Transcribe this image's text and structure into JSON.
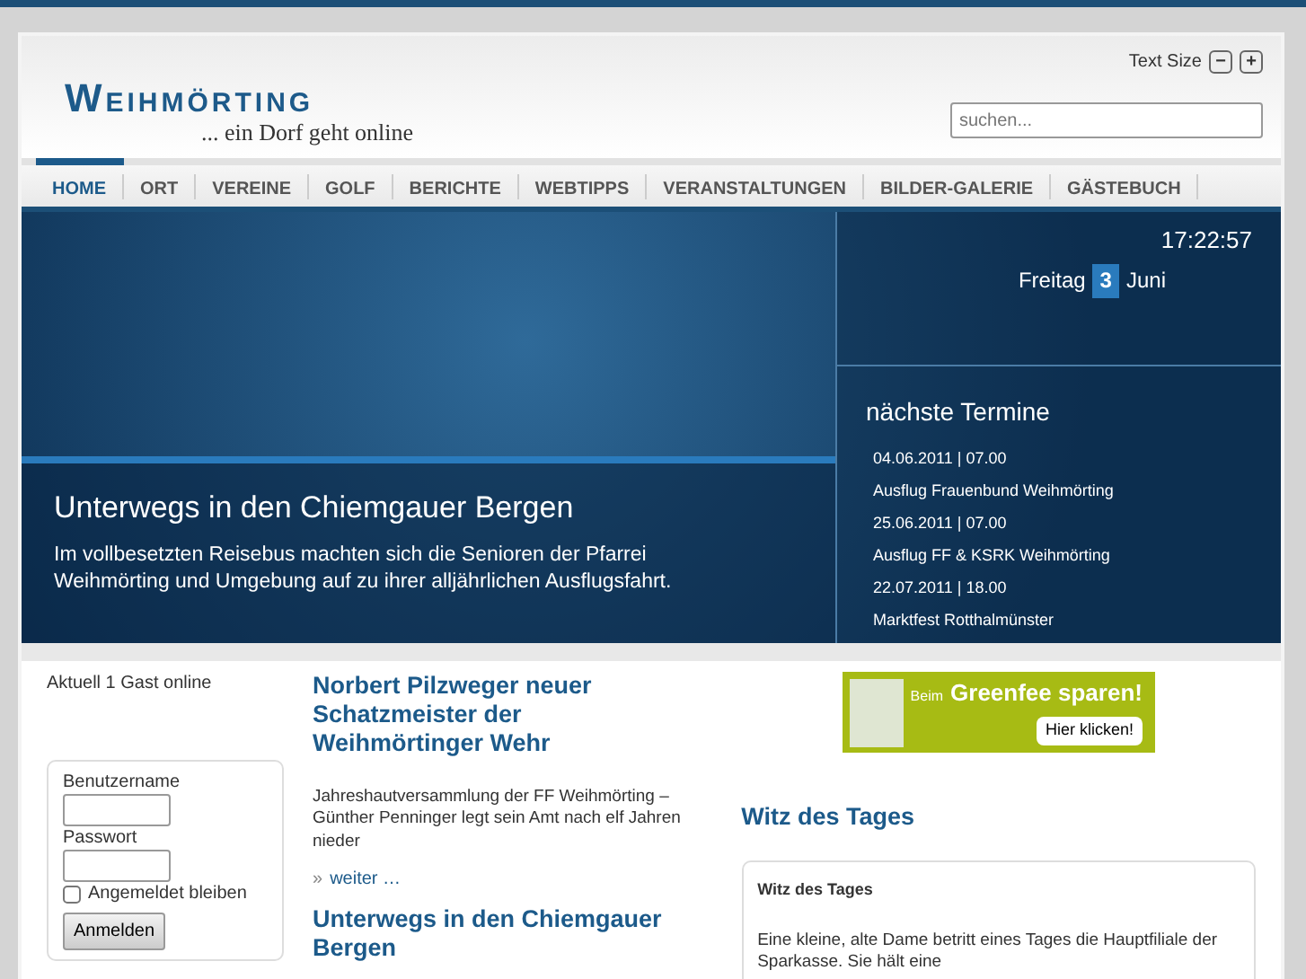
{
  "header": {
    "logo_title": "Weihmörting",
    "logo_tagline": "... ein Dorf geht online",
    "text_size_label": "Text Size",
    "text_size_buttons": [
      "−",
      "+"
    ],
    "search": {
      "placeholder": "suchen..."
    }
  },
  "nav": [
    {
      "label": "HOME",
      "selected": true
    },
    {
      "label": "ORT",
      "selected": false
    },
    {
      "label": "VEREINE",
      "selected": false
    },
    {
      "label": "GOLF",
      "selected": false
    },
    {
      "label": "BERICHTE",
      "selected": false
    },
    {
      "label": "WEBTIPPS",
      "selected": false
    },
    {
      "label": "VERANSTALTUNGEN",
      "selected": false
    },
    {
      "label": "BILDER-GALERIE",
      "selected": false
    },
    {
      "label": "GÄSTEBUCH",
      "selected": false
    }
  ],
  "hero": {
    "title": "Unterwegs in den Chiemgauer Bergen",
    "text": "Im vollbesetzten Reisebus machten sich die Senioren der Pfarrei Weihmörting und Umgebung auf zu ihrer alljährlichen Ausflugsfahrt."
  },
  "clock": {
    "time": "17:22:57",
    "weekday": "Freitag",
    "day": "3",
    "month": "Juni"
  },
  "events": {
    "title": "nächste Termine",
    "items": [
      {
        "date": "04.06.2011 | 07.00",
        "name": "Ausflug Frauenbund Weihmörting"
      },
      {
        "date": "25.06.2011 | 07.00",
        "name": "Ausflug FF & KSRK Weihmörting"
      },
      {
        "date": "22.07.2011 | 18.00",
        "name": "Marktfest Rotthalmünster"
      }
    ]
  },
  "sidebar": {
    "online": "Aktuell 1 Gast online",
    "login": {
      "username_label": "Benutzername",
      "password_label": "Passwort",
      "remember_label": "Angemeldet bleiben",
      "remember_checked": false,
      "submit": "Anmelden"
    }
  },
  "articles": [
    {
      "title": "Norbert Pilzweger neuer Schatzmeister der Weihmörtinger Wehr",
      "text": "Jahreshautversammlung der FF Weihmörting – Günther Penninger legt sein Amt nach elf Jahren nieder",
      "more_mark": "»",
      "more": "weiter …"
    },
    {
      "title": "Unterwegs in den Chiemgauer Bergen"
    }
  ],
  "ad": {
    "prefix": "Beim",
    "headline": "Greenfee sparen!",
    "button": "Hier klicken!"
  },
  "joke": {
    "heading": "Witz des Tages",
    "box_title": "Witz des Tages",
    "text": "Eine kleine, alte Dame betritt eines Tages die Hauptfiliale der Sparkasse. Sie hält eine"
  }
}
